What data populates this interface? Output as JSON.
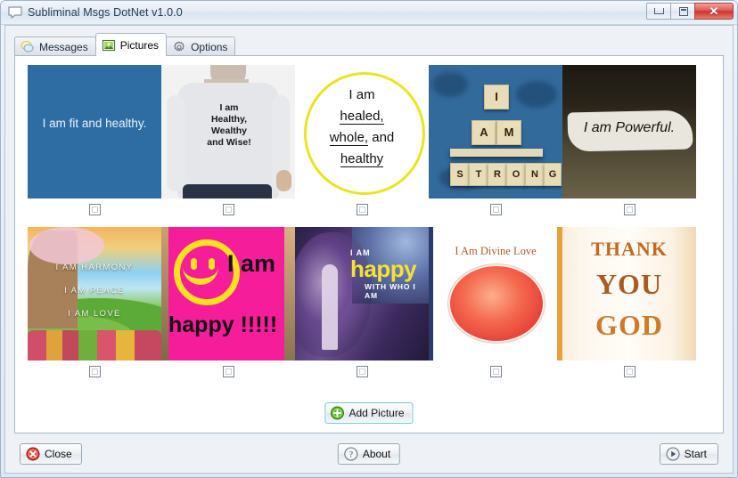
{
  "window": {
    "title": "Subliminal Msgs DotNet v1.0.0",
    "icon": "speech-bubble-icon",
    "buttons": {
      "minimize": "minimize-icon",
      "maximize": "maximize-icon",
      "close": "✕"
    }
  },
  "tabs": [
    {
      "label": "Messages",
      "icon": "speech-bubble-icon",
      "active": false
    },
    {
      "label": "Pictures",
      "icon": "picture-icon",
      "active": true
    },
    {
      "label": "Options",
      "icon": "gear-icon",
      "active": false
    }
  ],
  "pictures": {
    "rows": [
      [
        {
          "id": "pic-1",
          "caption": "I am fit and healthy.",
          "checked": false
        },
        {
          "id": "pic-2",
          "caption": "I am Healthy, Wealthy and Wise!",
          "checked": false
        },
        {
          "id": "pic-3",
          "caption": "I am healed, whole, and healthy",
          "checked": false
        },
        {
          "id": "pic-4",
          "caption": "I AM STRONG",
          "checked": false
        },
        {
          "id": "pic-5",
          "caption": "I am Powerful.",
          "checked": false
        }
      ],
      [
        {
          "id": "pic-6",
          "caption": "I AM HARMONY I AM PEACE I AM LOVE",
          "checked": false
        },
        {
          "id": "pic-7",
          "caption": "I am happy !!!!!",
          "checked": false
        },
        {
          "id": "pic-8",
          "caption": "I AM happy WITH WHO I AM",
          "checked": false
        },
        {
          "id": "pic-9",
          "caption": "I Am Divine Love",
          "checked": false
        },
        {
          "id": "pic-10",
          "caption": "THANK YOU GOD",
          "checked": false
        }
      ]
    ],
    "art": {
      "p1": {
        "line1": "I am fit and healthy."
      },
      "p2": {
        "line1": "I am",
        "line2": "Healthy,",
        "line3": "Wealthy",
        "line4": "and Wise!"
      },
      "p3": {
        "line1": "I am",
        "line2": "healed,",
        "line3": "whole,",
        "line3b": " and",
        "line4": "healthy"
      },
      "p4": {
        "t1": "I",
        "t2": "A",
        "t3": "M",
        "t4": "S",
        "t5": "T",
        "t6": "R",
        "t7": "O",
        "t8": "N",
        "t9": "G"
      },
      "p5": {
        "line1": "I am Powerful."
      },
      "p6": {
        "line1": "I AM HARMONY",
        "line2": "I AM PEACE",
        "line3": "I AM LOVE"
      },
      "p7": {
        "line1": "I am",
        "line2": "happy !!!!!"
      },
      "p8": {
        "line1": "I AM",
        "line2": "happy",
        "line3": "WITH WHO I AM"
      },
      "p9": {
        "line1": "I Am Divine Love"
      },
      "p10": {
        "line1": "THANK",
        "line2": "YOU",
        "line3": "GOD"
      }
    }
  },
  "buttons": {
    "add_picture": {
      "label": "Add Picture",
      "icon": "plus-circle-icon"
    },
    "close": {
      "label": "Close",
      "icon": "close-circle-icon"
    },
    "about": {
      "label": "About",
      "icon": "question-circle-icon"
    },
    "start": {
      "label": "Start",
      "icon": "play-circle-icon"
    }
  },
  "colors": {
    "accent_blue": "#2e6da4",
    "pink": "#f51d9a",
    "yellow": "#e9e520",
    "orange": "#c46a1e",
    "focus_border": "#6dc7e0"
  }
}
